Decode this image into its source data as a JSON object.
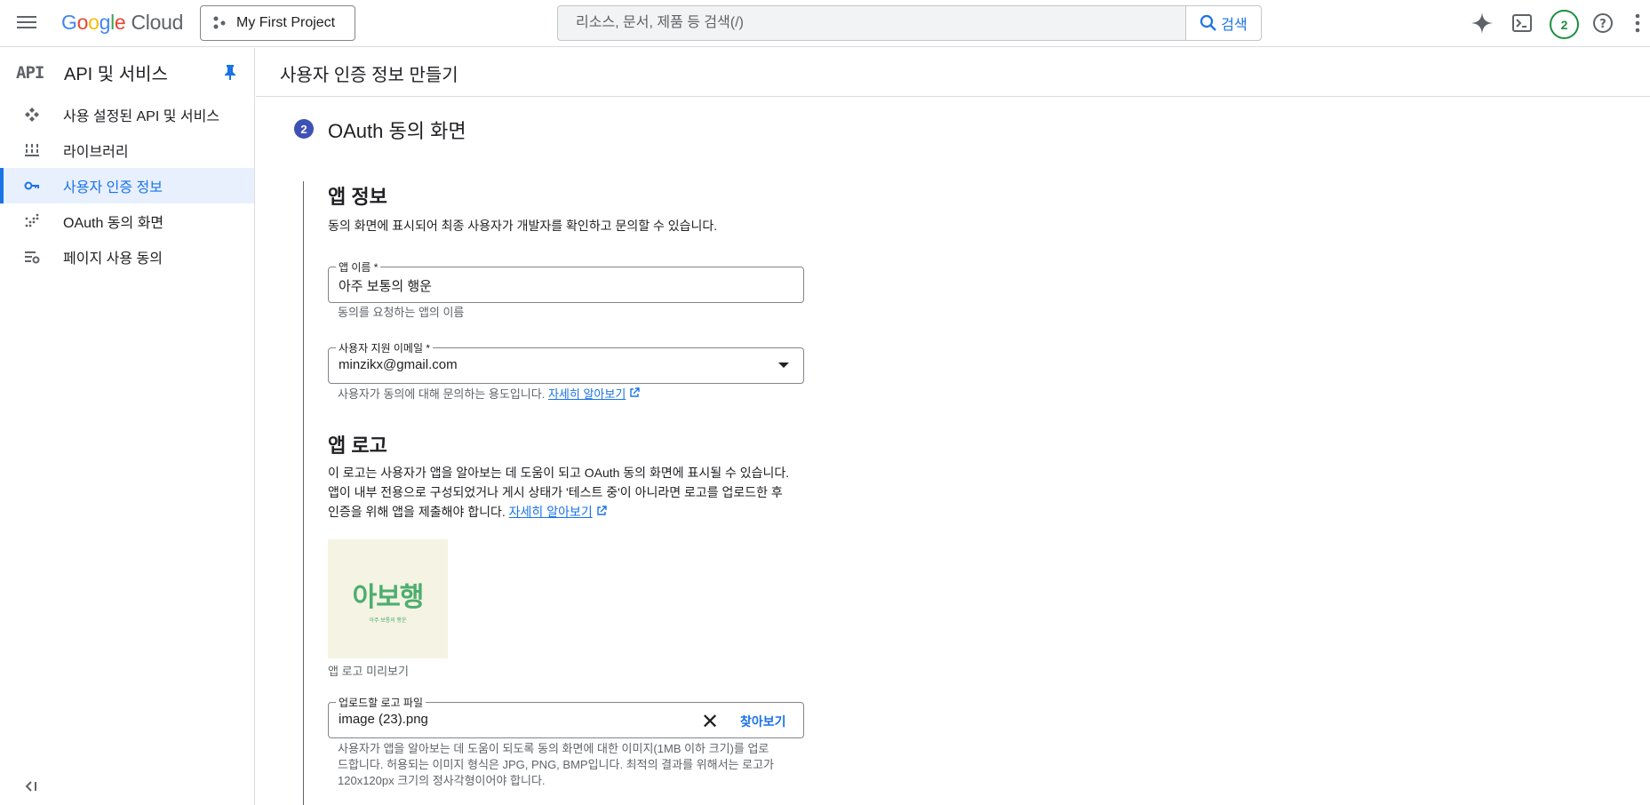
{
  "topbar": {
    "logo": {
      "google": "Google",
      "cloud": "Cloud"
    },
    "project": "My First Project",
    "search": {
      "placeholder": "리소스, 문서, 제품 등 검색(/)",
      "button": "검색"
    },
    "notifications_count": "2"
  },
  "sidebar": {
    "api_icon_text": "API",
    "title": "API 및 서비스",
    "items": [
      {
        "label": "사용 설정된 API 및 서비스",
        "icon": "api-diamond-icon"
      },
      {
        "label": "라이브러리",
        "icon": "library-icon"
      },
      {
        "label": "사용자 인증 정보",
        "icon": "key-icon"
      },
      {
        "label": "OAuth 동의 화면",
        "icon": "oauth-icon"
      },
      {
        "label": "페이지 사용 동의",
        "icon": "settings-list-icon"
      }
    ],
    "active_index": 2,
    "collapse": "<|"
  },
  "main": {
    "page_title": "사용자 인증 정보 만들기",
    "step_number": "2",
    "step_title": "OAuth 동의 화면",
    "app_info": {
      "heading": "앱 정보",
      "description": "동의 화면에 표시되어 최종 사용자가 개발자를 확인하고 문의할 수 있습니다.",
      "app_name": {
        "label": "앱 이름 *",
        "value": "아주 보통의 행운",
        "hint": "동의를 요청하는 앱의 이름"
      },
      "support_email": {
        "label": "사용자 지원 이메일 *",
        "value": "minzikx@gmail.com",
        "hint": "사용자가 동의에 대해 문의하는 용도입니다.",
        "link": "자세히 알아보기"
      }
    },
    "app_logo": {
      "heading": "앱 로고",
      "description_line1": "이 로고는 사용자가 앱을 알아보는 데 도움이 되고 OAuth 동의 화면에 표시될 수 있습니다.",
      "description_line2": "앱이 내부 전용으로 구성되었거나 게시 상태가 '테스트 중'이 아니라면 로고를 업로드한 후",
      "description_line3": "인증을 위해 앱을 제출해야 합니다.",
      "link": "자세히 알아보기",
      "preview_text_big": "아보행",
      "preview_text_small": "아주 보통의 행운",
      "preview_caption": "앱 로고 미리보기",
      "upload": {
        "label": "업로드할 로고 파일",
        "value": "image (23).png",
        "clear": "✕",
        "browse": "찾아보기"
      },
      "hint_line1": "사용자가 앱을 알아보는 데 도움이 되도록 동의 화면에 대한 이미지(1MB 이하 크기)를 업로",
      "hint_line2": "드합니다. 허용되는 이미지 형식은 JPG, PNG, BMP입니다. 최적의 결과를 위해서는 로고가",
      "hint_line3": "120x120px 크기의 정사각형이어야 합니다."
    }
  },
  "colors": {
    "accent": "#1a73e8",
    "step": "#3f51b5",
    "badge": "#1e8e3e",
    "logo_green": "#4cae6e"
  }
}
